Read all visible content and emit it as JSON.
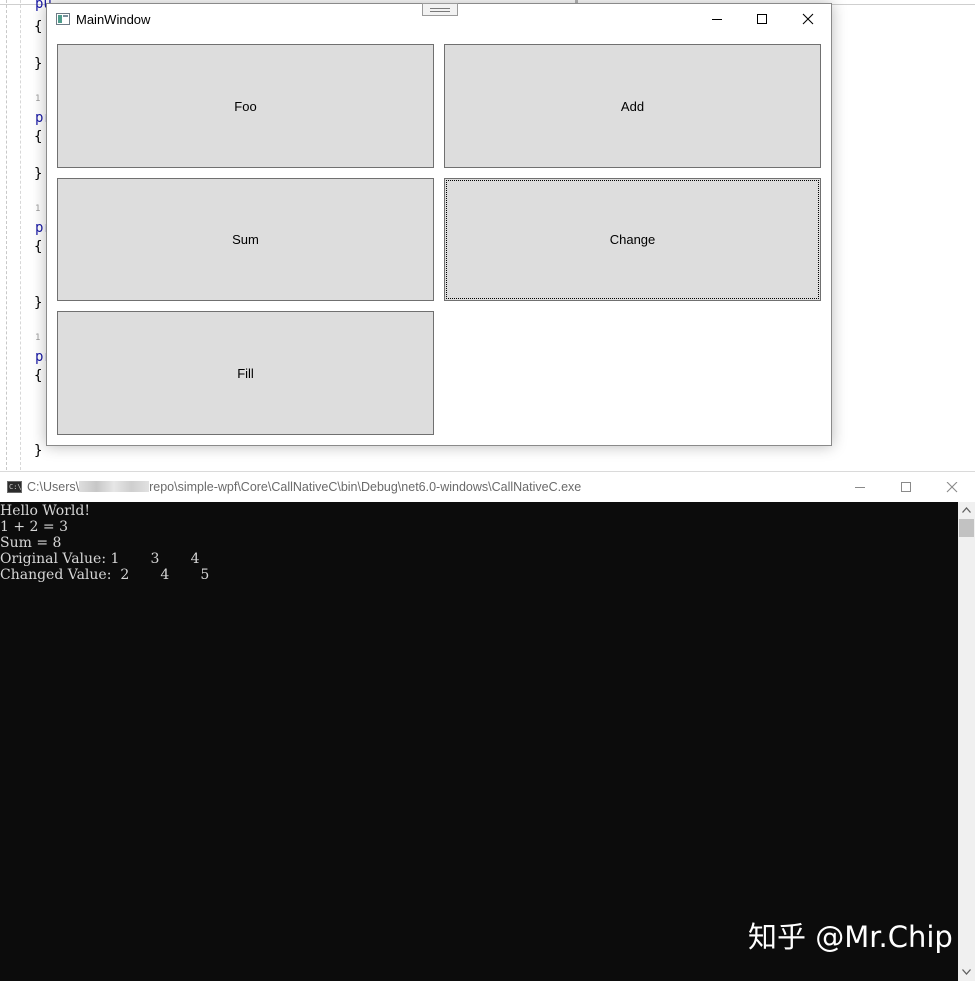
{
  "editor": {
    "lines": [
      {
        "text": "pu",
        "type": "keyword"
      },
      {
        "text": "{",
        "type": "brace"
      },
      {
        "text": "}",
        "type": "brace"
      },
      {
        "text": "1",
        "type": "refcount"
      },
      {
        "text": "pr",
        "type": "keyword"
      },
      {
        "text": "{",
        "type": "brace"
      },
      {
        "text": "}",
        "type": "brace"
      },
      {
        "text": "1",
        "type": "refcount"
      },
      {
        "text": "pr",
        "type": "keyword"
      },
      {
        "text": "{",
        "type": "brace"
      },
      {
        "text": "}",
        "type": "brace"
      },
      {
        "text": "1",
        "type": "refcount"
      },
      {
        "text": "pr",
        "type": "keyword"
      },
      {
        "text": "{",
        "type": "brace"
      },
      {
        "text": "}",
        "type": "brace"
      }
    ]
  },
  "main_window": {
    "title": "MainWindow",
    "buttons": {
      "foo": "Foo",
      "add": "Add",
      "sum": "Sum",
      "change": "Change",
      "fill": "Fill"
    },
    "focused_button": "Change"
  },
  "console": {
    "title_prefix": "C:\\Users\\",
    "title_suffix": "repo\\simple-wpf\\Core\\CallNativeC\\bin\\Debug\\net6.0-windows\\CallNativeC.exe",
    "icon_text": "C:\\",
    "output": [
      "Hello World!",
      "1 + 2 = 3",
      "Sum = 8",
      "Original Value: 1       3       4",
      "Changed Value:  2       4       5"
    ]
  },
  "watermark": "知乎 @Mr.Chip"
}
